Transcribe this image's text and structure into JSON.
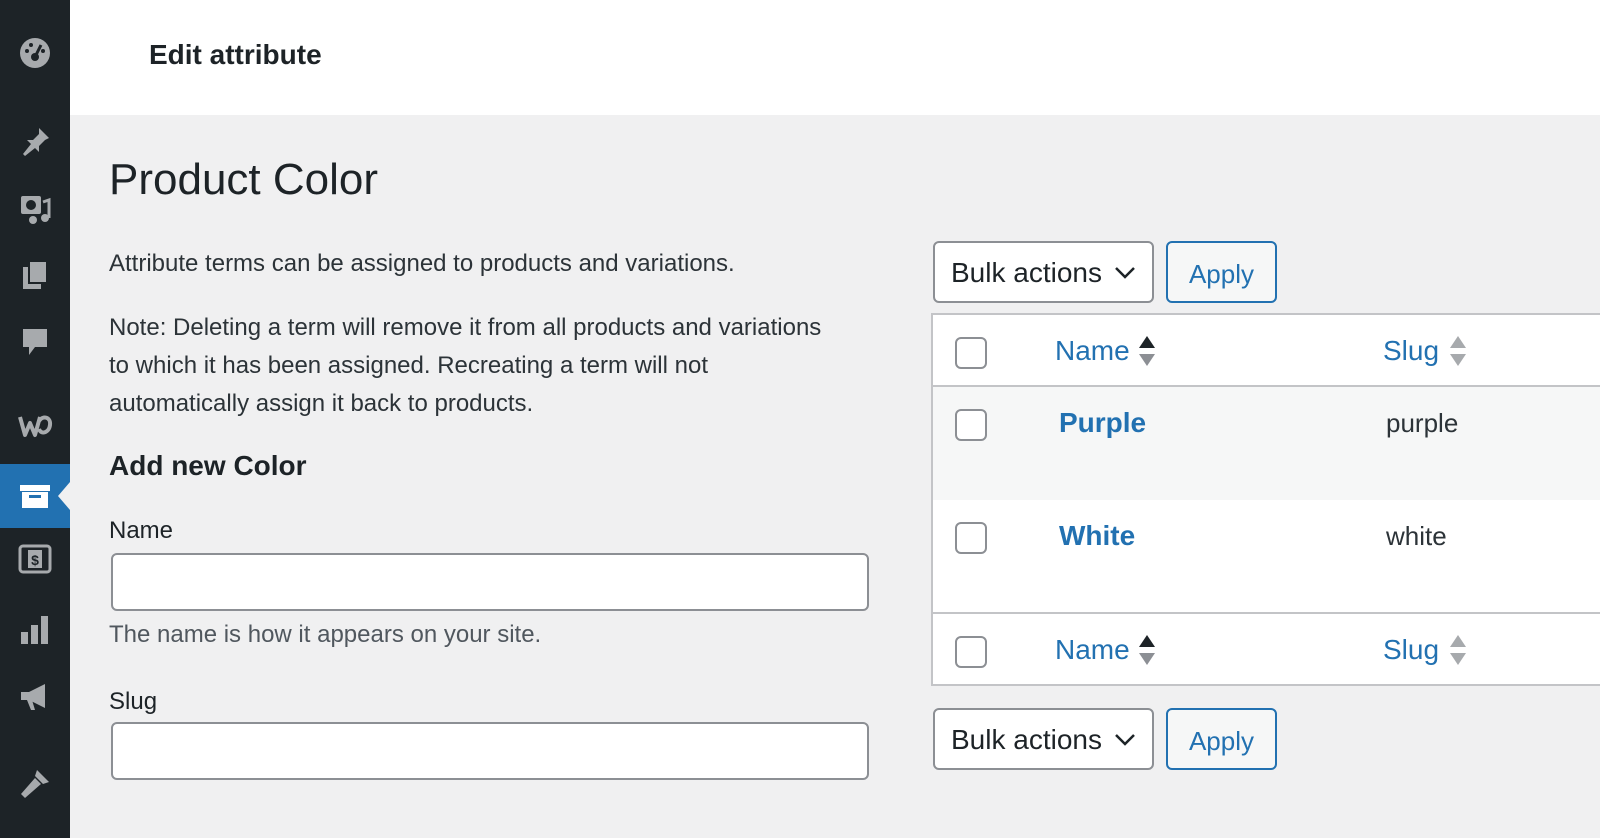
{
  "sidebar": {
    "items": [
      {
        "icon": "dashboard-icon"
      },
      {
        "icon": "pin-icon"
      },
      {
        "icon": "media-icon"
      },
      {
        "icon": "pages-icon"
      },
      {
        "icon": "comments-icon"
      },
      {
        "icon": "woocommerce-icon"
      },
      {
        "icon": "products-icon",
        "active": true
      },
      {
        "icon": "payments-icon"
      },
      {
        "icon": "analytics-icon"
      },
      {
        "icon": "marketing-icon"
      },
      {
        "icon": "appearance-icon"
      }
    ],
    "accent": "#2271b1"
  },
  "header": {
    "title": "Edit attribute"
  },
  "page": {
    "title": "Product Color",
    "intro": "Attribute terms can be assigned to products and variations.",
    "note_line1": "Note: Deleting a term will remove it from all products and variations",
    "note_line2": "to which it has been assigned. Recreating a term will not",
    "note_line3": "automatically assign it back to products."
  },
  "form": {
    "section_title": "Add new Color",
    "name_label": "Name",
    "name_value": "",
    "name_help": "The name is how it appears on your site.",
    "slug_label": "Slug",
    "slug_value": ""
  },
  "table": {
    "bulk_actions_label": "Bulk actions",
    "apply_label": "Apply",
    "columns": {
      "name": "Name",
      "slug": "Slug"
    },
    "rows": [
      {
        "name": "Purple",
        "slug": "purple"
      },
      {
        "name": "White",
        "slug": "white"
      }
    ]
  }
}
